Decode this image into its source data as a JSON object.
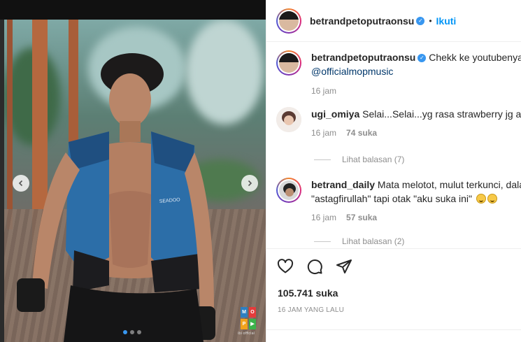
{
  "post": {
    "author": "betrandpetoputraonsu",
    "follow_label": "Ikuti",
    "separator": "•",
    "likes_label": "105.741 suka",
    "time_label": "16 JAM YANG LALU",
    "carousel": {
      "total_slides": 3,
      "active_slide": 1
    }
  },
  "media": {
    "prev_icon": "chevron-left-icon",
    "next_icon": "chevron-right-icon",
    "watermark": [
      "M",
      "O",
      "P",
      "▶"
    ],
    "watermark_credit": "ibi official"
  },
  "comments": [
    {
      "username": "betrandpetoputraonsu",
      "text": "Chekk ke youtubenya c",
      "mention": "@officialmopmusic",
      "time": "16 jam",
      "likes": "",
      "replies": ""
    },
    {
      "username": "ugi_omiya",
      "text": "Selai...Selai...yg rasa strawberry jg ada",
      "time": "16 jam",
      "likes": "74 suka",
      "replies": "Lihat balasan (7)"
    },
    {
      "username": "betrand_daily",
      "text": "Mata melotot, mulut terkunci, dala",
      "text2": "\"astagfirullah\" tapi otak \"aku suka ini\"",
      "time": "16 jam",
      "likes": "57 suka",
      "replies": "Lihat balasan (2)"
    }
  ],
  "icons": {
    "like": "heart-icon",
    "comment": "comment-icon",
    "share": "share-icon",
    "verified": "verified-badge-icon"
  },
  "colors": {
    "accent": "#0095f6",
    "verified": "#3897f0",
    "muted_text": "#8e8e8e",
    "mention": "#00376b"
  }
}
